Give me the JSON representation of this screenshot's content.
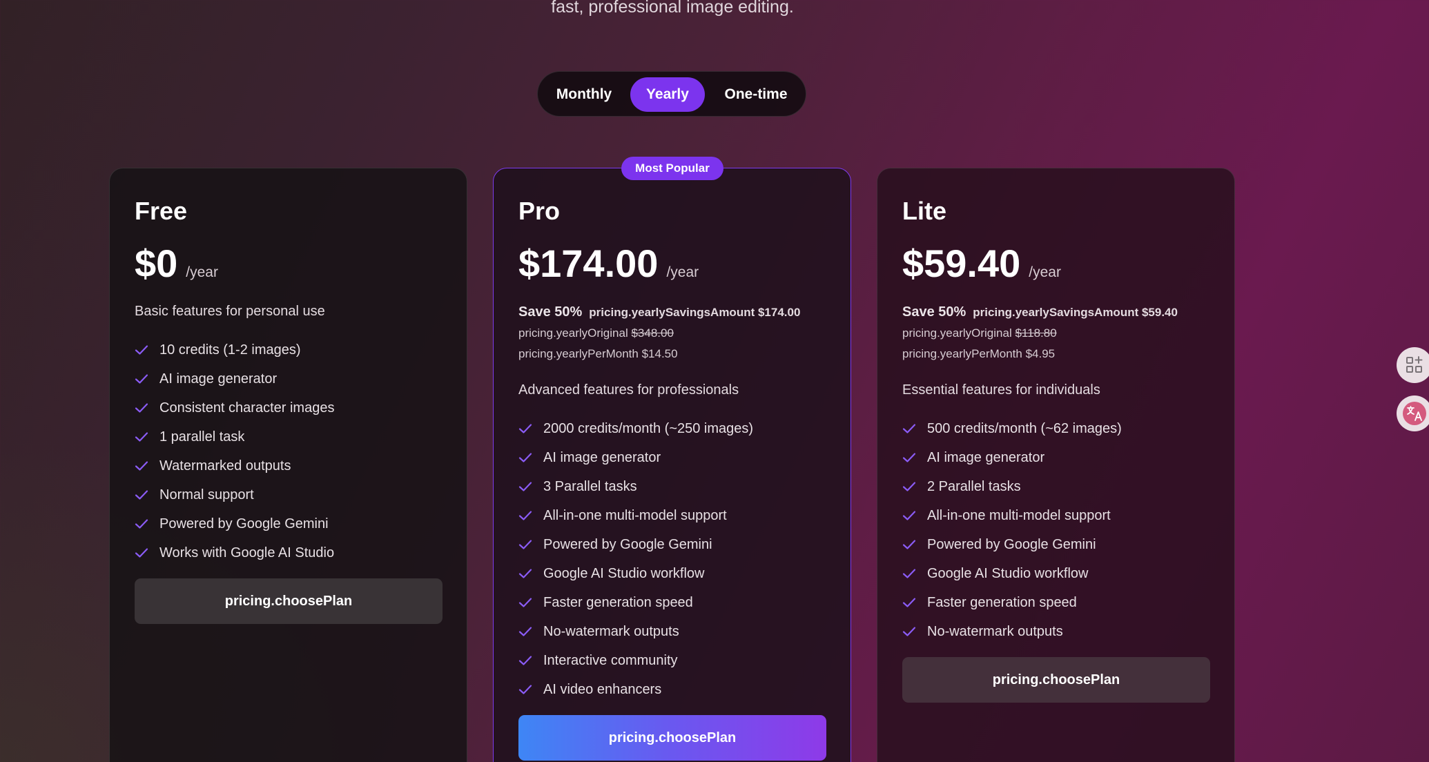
{
  "header": {
    "subtitle": "fast, professional image editing."
  },
  "billing_toggle": {
    "options": [
      "Monthly",
      "Yearly",
      "One-time"
    ],
    "selected": "Yearly"
  },
  "plans": [
    {
      "name": "Free",
      "price": "$0",
      "period": "/year",
      "description": "Basic features for personal use",
      "features": [
        "10 credits (1-2 images)",
        "AI image generator",
        "Consistent character images",
        "1 parallel task",
        "Watermarked outputs",
        "Normal support",
        "Powered by Google Gemini",
        "Works with Google AI Studio"
      ],
      "button": "pricing.choosePlan"
    },
    {
      "name": "Pro",
      "badge": "Most Popular",
      "price": "$174.00",
      "period": "/year",
      "save_percent": "Save 50%",
      "savings_amount": "pricing.yearlySavingsAmount $174.00",
      "original_label": "pricing.yearlyOriginal",
      "original_value": "$348.00",
      "per_month_label": "pricing.yearlyPerMonth",
      "per_month_value": "$14.50",
      "description": "Advanced features for professionals",
      "features": [
        "2000 credits/month (~250 images)",
        "AI image generator",
        "3 Parallel tasks",
        "All-in-one multi-model support",
        "Powered by Google Gemini",
        "Google AI Studio workflow",
        "Faster generation speed",
        "No-watermark outputs",
        "Interactive community",
        "AI video enhancers"
      ],
      "button": "pricing.choosePlan"
    },
    {
      "name": "Lite",
      "price": "$59.40",
      "period": "/year",
      "save_percent": "Save 50%",
      "savings_amount": "pricing.yearlySavingsAmount $59.40",
      "original_label": "pricing.yearlyOriginal",
      "original_value": "$118.80",
      "per_month_label": "pricing.yearlyPerMonth",
      "per_month_value": "$4.95",
      "description": "Essential features for individuals",
      "features": [
        "500 credits/month (~62 images)",
        "AI image generator",
        "2 Parallel tasks",
        "All-in-one multi-model support",
        "Powered by Google Gemini",
        "Google AI Studio workflow",
        "Faster generation speed",
        "No-watermark outputs"
      ],
      "button": "pricing.choosePlan"
    }
  ],
  "side_widgets": [
    {
      "icon": "apps-add-icon"
    },
    {
      "icon": "translate-icon"
    }
  ],
  "colors": {
    "accent": "#7c34ee",
    "check": "#8b5cf6",
    "button_gradient_start": "#3e86f5",
    "button_gradient_end": "#8e3ae8"
  }
}
